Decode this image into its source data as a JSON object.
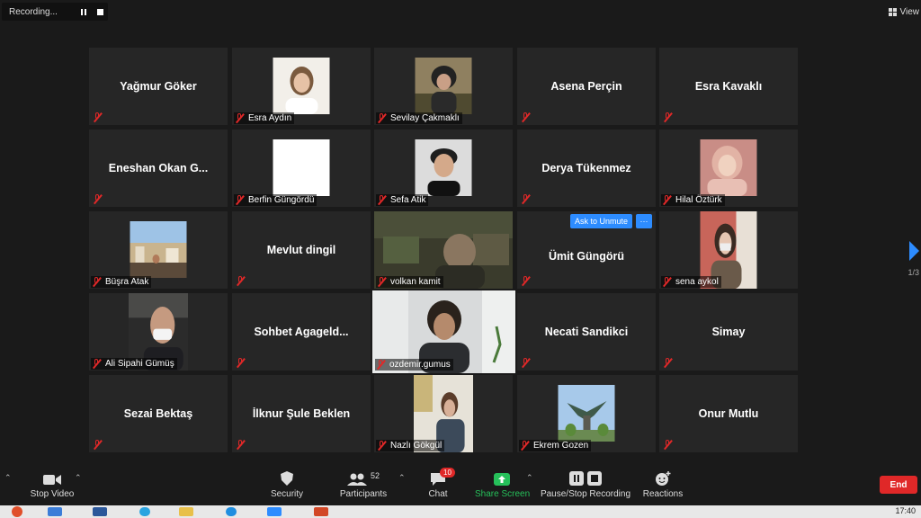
{
  "recording": {
    "label": "Recording..."
  },
  "view_button": {
    "label": "View"
  },
  "participants": [
    {
      "name": "Yağmur Göker",
      "label": ""
    },
    {
      "name": "",
      "label": "Esra Aydın"
    },
    {
      "name": "",
      "label": "Sevilay Çakmaklı"
    },
    {
      "name": "Asena Perçin",
      "label": ""
    },
    {
      "name": "Esra Kavaklı",
      "label": ""
    },
    {
      "name": "Eneshan  Okan  G...",
      "label": ""
    },
    {
      "name": "",
      "label": "Berfin Güngördü"
    },
    {
      "name": "",
      "label": "Sefa Atik"
    },
    {
      "name": "Derya Tükenmez",
      "label": ""
    },
    {
      "name": "",
      "label": "Hilal Öztürk"
    },
    {
      "name": "",
      "label": "Büşra Atak"
    },
    {
      "name": "Mevlut dingil",
      "label": ""
    },
    {
      "name": "",
      "label": "volkan kamit"
    },
    {
      "name": "Ümit Güngörü",
      "label": ""
    },
    {
      "name": "",
      "label": "sena aykol"
    },
    {
      "name": "",
      "label": "Ali Sipahi Gümüş"
    },
    {
      "name": "Sohbet  Agageld...",
      "label": ""
    },
    {
      "name": "",
      "label": "ozdemir.gumus"
    },
    {
      "name": "Necati Sandikci",
      "label": ""
    },
    {
      "name": "Simay",
      "label": ""
    },
    {
      "name": "Sezai Bektaş",
      "label": ""
    },
    {
      "name": "İlknur Şule Beklen",
      "label": ""
    },
    {
      "name": "",
      "label": "Nazlı Gökgül"
    },
    {
      "name": "",
      "label": "Ekrem Gozen"
    },
    {
      "name": "Onur Mutlu",
      "label": ""
    }
  ],
  "tile_actions": {
    "ask_to_unmute": "Ask to Unmute",
    "more": "···"
  },
  "pagination": {
    "text": "1/3"
  },
  "toolbar": {
    "stop_video": "Stop Video",
    "security": "Security",
    "participants": "Participants",
    "participants_count": "52",
    "chat": "Chat",
    "chat_badge": "10",
    "share_screen": "Share Screen",
    "pause_stop_recording": "Pause/Stop Recording",
    "reactions": "Reactions",
    "end": "End"
  },
  "taskbar": {
    "clock": "17:40"
  },
  "colors": {
    "accent": "#2d8cff",
    "end": "#e02828",
    "share": "#26c05a",
    "active_speaker": "#d4e157"
  }
}
